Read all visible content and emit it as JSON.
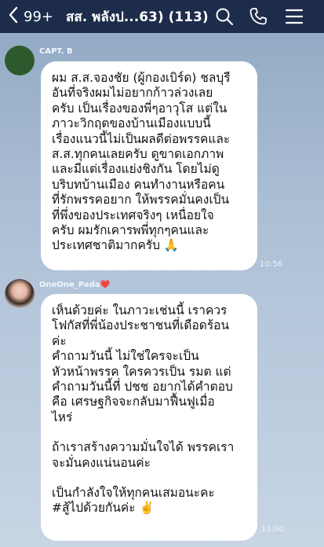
{
  "header": {
    "back_count": "99+",
    "chat_title": "สส. พลังป...63) (113)",
    "icons": [
      "chevron-left-icon",
      "search-icon",
      "phone-icon",
      "menu-icon"
    ]
  },
  "messages": [
    {
      "sender": "CAPT. B",
      "lines": [
        "ผม ส.ส.จองชัย (ผู้กองเบิร์ด) ชลบุรี",
        "อันที่จริงผมไม่อยากก้าวล่วงเลย",
        "ครับ เป็นเรื่องของพี่ๆอาวุโส แต่ใน",
        "ภาวะวิกฤตของบ้านเมืองแบบนี้",
        "เรื่องแนวนี้ไม่เป็นผลดีต่อพรรคและ",
        "ส.ส.ทุกคนเลยครับ ดูขาดเอกภาพ",
        "และมีแต่เรื่องแย่งชิงกัน โดยไม่ดู",
        "บริบทบ้านเมือง คนทำงานหรือคน",
        "ที่รักพรรคอยาก ให้พรรคมั่นคงเป็น",
        "ที่พึ่งของประเทศจริงๆ เหนื่อยใจ",
        "ครับ ผมรักเคารพพี่ทุกๆคนและ",
        "ประเทศชาติมากครับ 🙏"
      ],
      "time": "10:56"
    },
    {
      "sender": "OneOne_Pada",
      "sender_suffix": "❤️",
      "lines": [
        "เห็นด้วยค่ะ ในภาวะเช่นนี้ เราควร",
        "โฟกัสที่พี่น้องประชาชนที่เดือดร้อน",
        "ค่ะ",
        "คำถามวันนี้ ไม่ใช่ใครจะเป็น",
        "หัวหน้าพรรค ใครควรเป็น รมต แต่",
        "คำถามวันนี้ที่ ปชช อยากได้คำตอบ",
        "คือ เศรษฐกิจจะกลับมาฟื้นฟูเมื่อ",
        "ไหร่",
        "",
        "ถ้าเราสร้างความมั่นใจได้ พรรคเรา",
        "จะมั่นคงแน่นอนค่ะ",
        "",
        "เป็นกำลังใจให้ทุกคนเสมอนะคะ",
        "#สู้ไปด้วยกันค่ะ ✌️"
      ],
      "time": "11:00"
    }
  ],
  "colors": {
    "header_bg": "#1d2c4a",
    "bubble_bg": "#ffffff",
    "avatar1": "#2d5a2d"
  }
}
